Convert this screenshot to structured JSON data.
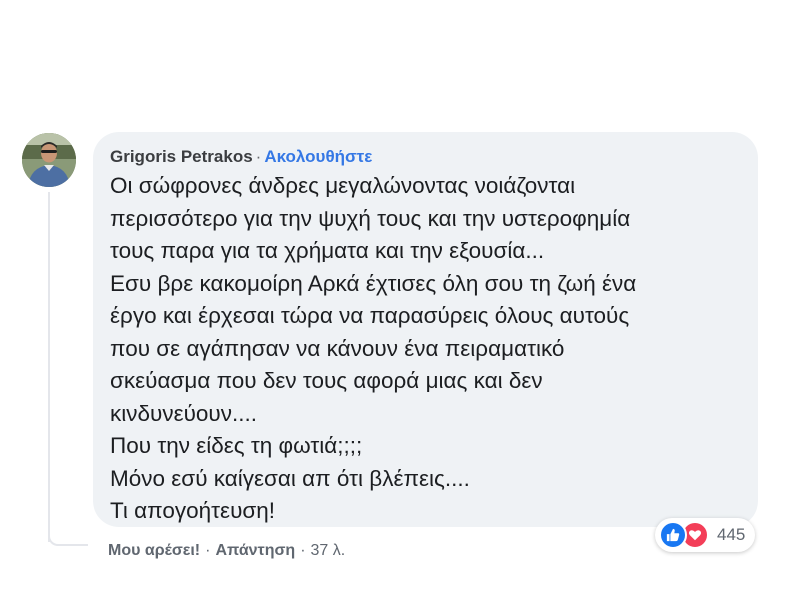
{
  "comment": {
    "author": "Grigoris Petrakos",
    "separator": "·",
    "follow_label": "Ακολουθήστε",
    "lines": [
      "Οι σώφρονες άνδρες μεγαλώνοντας νοιάζονται",
      "περισσότερο για την ψυχή τους και την υστεροφημία",
      "τους παρα για τα χρήματα και την εξουσία...",
      "Εσυ βρε κακομοίρη Αρκά έχτισες όλη σου τη ζωή ένα",
      "έργο και έρχεσαι τώρα να παρασύρεις όλους αυτούς",
      "που σε αγάπησαν να κάνουν ένα πειραματικό",
      "σκεύασμα που δεν τους αφορά μιας και δεν",
      "κινδυνεύουν....",
      "Που την είδες τη φωτιά;;;;",
      "Μόνο εσύ καίγεσαι απ ότι βλέπεις....",
      "Τι απογοήτευση!"
    ]
  },
  "reactions": {
    "icons": [
      "like-icon",
      "love-icon"
    ],
    "count": "445",
    "colors": {
      "like": "#1877f2",
      "love": "#f33e58"
    }
  },
  "actions": {
    "like_label": "Μου αρέσει!",
    "reply_label": "Απάντηση",
    "separator": "·",
    "timestamp": "37 λ."
  },
  "colors": {
    "bubble_bg": "#eff2f5",
    "link": "#3578e5",
    "text": "#1c1e21",
    "muted": "#606770"
  }
}
